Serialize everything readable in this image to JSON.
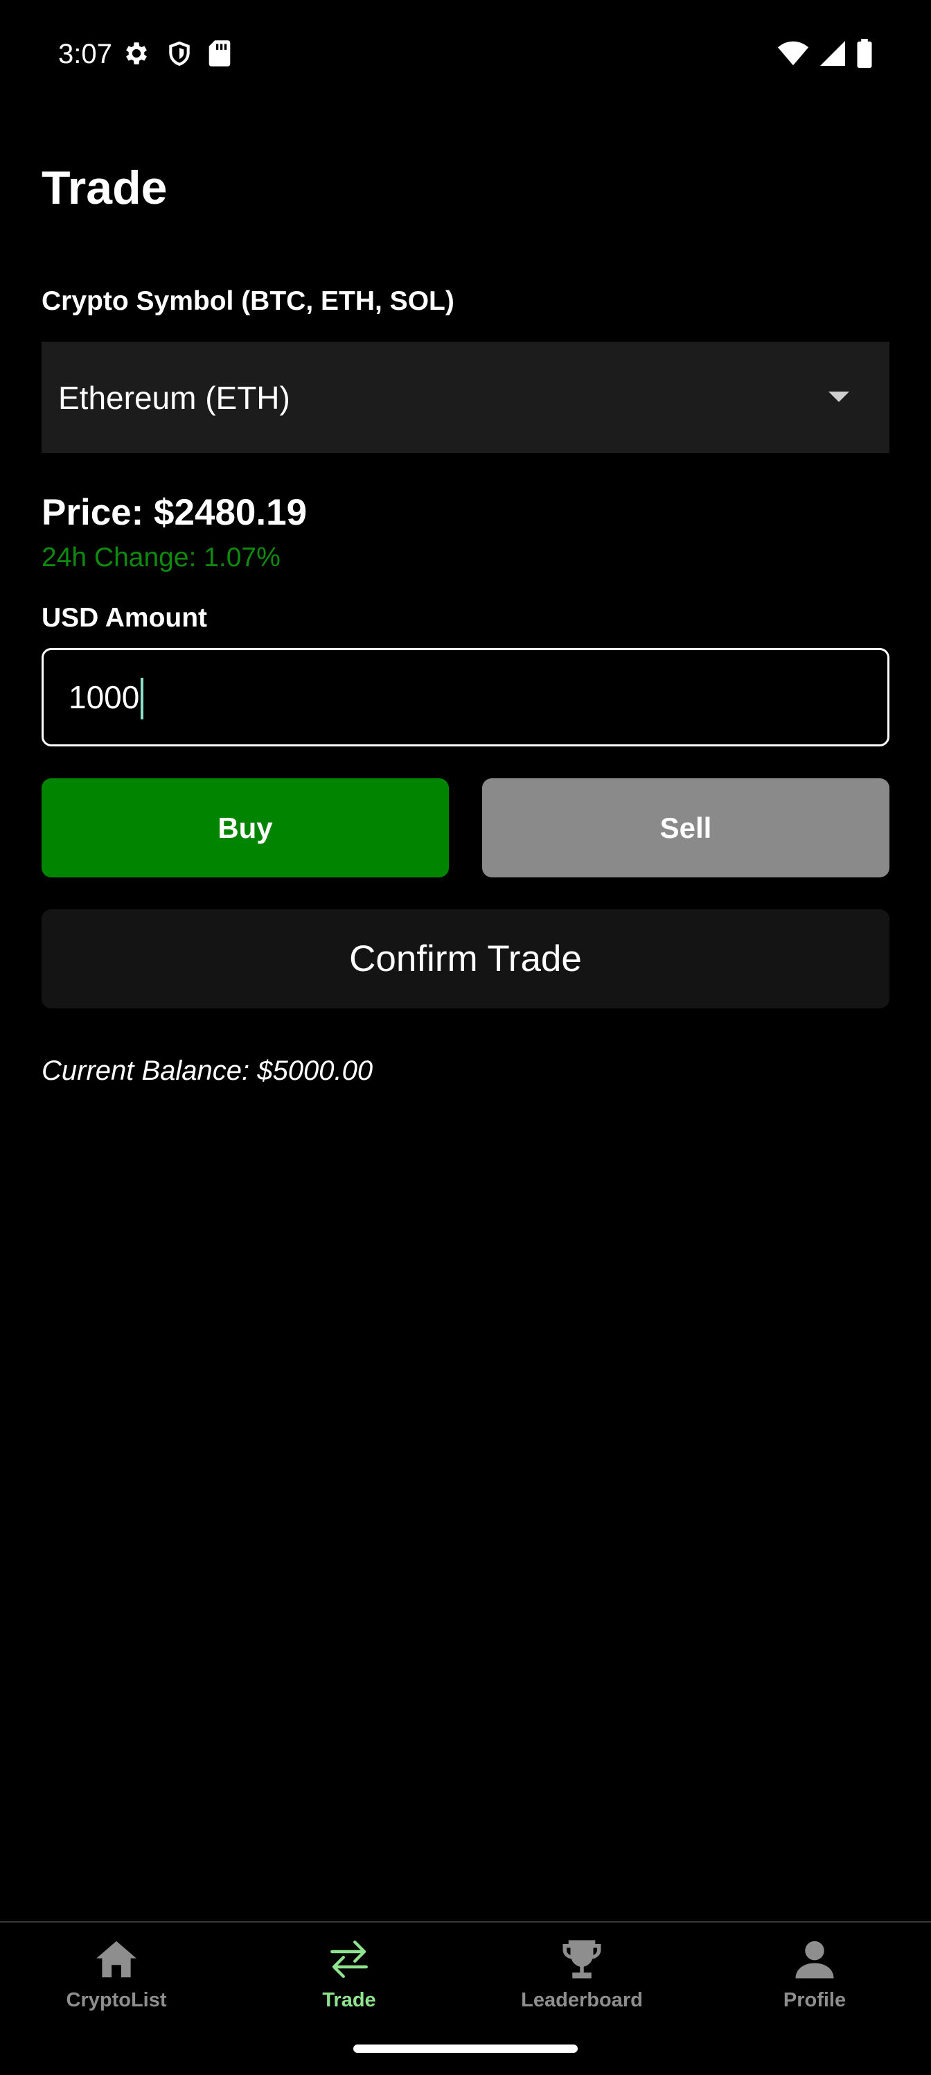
{
  "status_bar": {
    "time": "3:07"
  },
  "page": {
    "title": "Trade"
  },
  "symbol": {
    "label": "Crypto Symbol (BTC, ETH, SOL)",
    "selected": "Ethereum (ETH)"
  },
  "quote": {
    "price": "Price: $2480.19",
    "change": "24h Change: 1.07%",
    "change_color": "#0f8a0f"
  },
  "amount": {
    "label": "USD Amount",
    "value": "1000"
  },
  "actions": {
    "buy_label": "Buy",
    "sell_label": "Sell",
    "confirm_label": "Confirm Trade",
    "buy_color": "#018501",
    "sell_color": "#8a8a8a"
  },
  "balance": {
    "text": "Current Balance: $5000.00"
  },
  "nav": {
    "active_color": "#8fe38f",
    "inactive_color": "#8e8e8e",
    "items": [
      {
        "label": "CryptoList",
        "icon": "home-icon",
        "active": false
      },
      {
        "label": "Trade",
        "icon": "swap-arrows-icon",
        "active": true
      },
      {
        "label": "Leaderboard",
        "icon": "trophy-icon",
        "active": false
      },
      {
        "label": "Profile",
        "icon": "person-icon",
        "active": false
      }
    ]
  }
}
